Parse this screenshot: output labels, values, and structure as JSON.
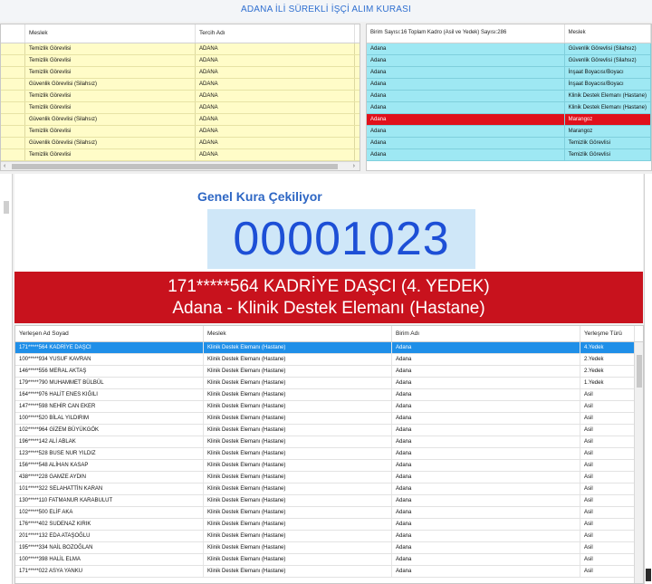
{
  "app": {
    "title": "ADANA İLİ SÜREKLİ İŞÇİ ALIM KURASI"
  },
  "left_grid": {
    "headers": [
      "",
      "Meslek",
      "Tercih Adı"
    ],
    "rows": [
      [
        "",
        "Temizlik Görevlisi",
        "ADANA"
      ],
      [
        "",
        "Temizlik Görevlisi",
        "ADANA"
      ],
      [
        "",
        "Temizlik Görevlisi",
        "ADANA"
      ],
      [
        "",
        "Güvenlik Görevlisi (Silahsız)",
        "ADANA"
      ],
      [
        "",
        "Temizlik Görevlisi",
        "ADANA"
      ],
      [
        "",
        "Temizlik Görevlisi",
        "ADANA"
      ],
      [
        "",
        "Güvenlik Görevlisi (Silahsız)",
        "ADANA"
      ],
      [
        "",
        "Temizlik Görevlisi",
        "ADANA"
      ],
      [
        "",
        "Güvenlik Görevlisi (Silahsız)",
        "ADANA"
      ],
      [
        "",
        "Temizlik Görevlisi",
        "ADANA"
      ]
    ],
    "scroll_left": "‹",
    "scroll_right": "›"
  },
  "right_grid": {
    "headers": [
      "Birim Sayısı:16 Toplam Kadro (Asil ve Yedek) Sayısı:286",
      "Meslek"
    ],
    "selected_index": 6,
    "rows": [
      [
        "Adana",
        "Güvenlik Görevlisi (Silahsız)"
      ],
      [
        "Adana",
        "Güvenlik Görevlisi (Silahsız)"
      ],
      [
        "Adana",
        "İnşaat Boyacısı/Boyacı"
      ],
      [
        "Adana",
        "İnşaat Boyacısı/Boyacı"
      ],
      [
        "Adana",
        "Klinik Destek Elemanı (Hastane)"
      ],
      [
        "Adana",
        "Klinik Destek Elemanı (Hastane)"
      ],
      [
        "Adana",
        "Marangoz"
      ],
      [
        "Adana",
        "Marangoz"
      ],
      [
        "Adana",
        "Temizlik Görevlisi"
      ],
      [
        "Adana",
        "Temizlik Görevlisi"
      ]
    ]
  },
  "draw": {
    "label": "Genel Kura Çekiliyor",
    "counter": "00001023",
    "winner_name": "171*****564 KADRİYE DAŞCI (4. YEDEK)",
    "winner_detail": "Adana - Klinik Destek Elemanı (Hastane)"
  },
  "results_grid": {
    "headers": [
      "Yerleşen Ad Soyad",
      "Meslek",
      "Birim Adı",
      "Yerleşme Türü"
    ],
    "selected_index": 0,
    "rows": [
      [
        "171*****564 KADRİYE DAŞCI",
        "Klinik Destek Elemanı (Hastane)",
        "Adana",
        "4.Yedek"
      ],
      [
        "100*****934 YUSUF KAVRAN",
        "Klinik Destek Elemanı (Hastane)",
        "Adana",
        "2.Yedek"
      ],
      [
        "146*****556 MERAL AKTAŞ",
        "Klinik Destek Elemanı (Hastane)",
        "Adana",
        "2.Yedek"
      ],
      [
        "179*****790 MUHAMMET BÜLBÜL",
        "Klinik Destek Elemanı (Hastane)",
        "Adana",
        "1.Yedek"
      ],
      [
        "164*****976 HALİT ENES KIĞILI",
        "Klinik Destek Elemanı (Hastane)",
        "Adana",
        "Asil"
      ],
      [
        "147*****598 NEHİR CAN EKER",
        "Klinik Destek Elemanı (Hastane)",
        "Adana",
        "Asil"
      ],
      [
        "100*****520 BİLAL YILDIRIM",
        "Klinik Destek Elemanı (Hastane)",
        "Adana",
        "Asil"
      ],
      [
        "102*****964 GİZEM BÜYÜKGÖK",
        "Klinik Destek Elemanı (Hastane)",
        "Adana",
        "Asil"
      ],
      [
        "196*****142 ALİ ABLAK",
        "Klinik Destek Elemanı (Hastane)",
        "Adana",
        "Asil"
      ],
      [
        "123*****528 BUSE NUR YILDIZ",
        "Klinik Destek Elemanı (Hastane)",
        "Adana",
        "Asil"
      ],
      [
        "156*****548 ALİHAN KASAP",
        "Klinik Destek Elemanı (Hastane)",
        "Adana",
        "Asil"
      ],
      [
        "438*****228 GAMZE AYDIN",
        "Klinik Destek Elemanı (Hastane)",
        "Adana",
        "Asil"
      ],
      [
        "101*****322 SELAHATTİN KARAN",
        "Klinik Destek Elemanı (Hastane)",
        "Adana",
        "Asil"
      ],
      [
        "130*****110 FATMANUR KARABULUT",
        "Klinik Destek Elemanı (Hastane)",
        "Adana",
        "Asil"
      ],
      [
        "102*****500 ELİF AKA",
        "Klinik Destek Elemanı (Hastane)",
        "Adana",
        "Asil"
      ],
      [
        "176*****402 SUDENAZ KIRIK",
        "Klinik Destek Elemanı (Hastane)",
        "Adana",
        "Asil"
      ],
      [
        "201*****132 EDA ATAŞOĞLU",
        "Klinik Destek Elemanı (Hastane)",
        "Adana",
        "Asil"
      ],
      [
        "195*****334 NAİL BOZOĞLAN",
        "Klinik Destek Elemanı (Hastane)",
        "Adana",
        "Asil"
      ],
      [
        "100*****398 HALİL ELMA",
        "Klinik Destek Elemanı (Hastane)",
        "Adana",
        "Asil"
      ],
      [
        "171*****022 ASYA YANKU",
        "Klinik Destek Elemanı (Hastane)",
        "Adana",
        "Asil"
      ]
    ]
  },
  "colors": {
    "title_blue": "#2f6fd0",
    "left_row_yellow": "#fffcc8",
    "right_row_cyan": "#9ee8f3",
    "selected_red": "#e0101b",
    "banner_red": "#c8121d",
    "selected_blue": "#1f8fe8",
    "counter_blue": "#1d4fd6"
  }
}
